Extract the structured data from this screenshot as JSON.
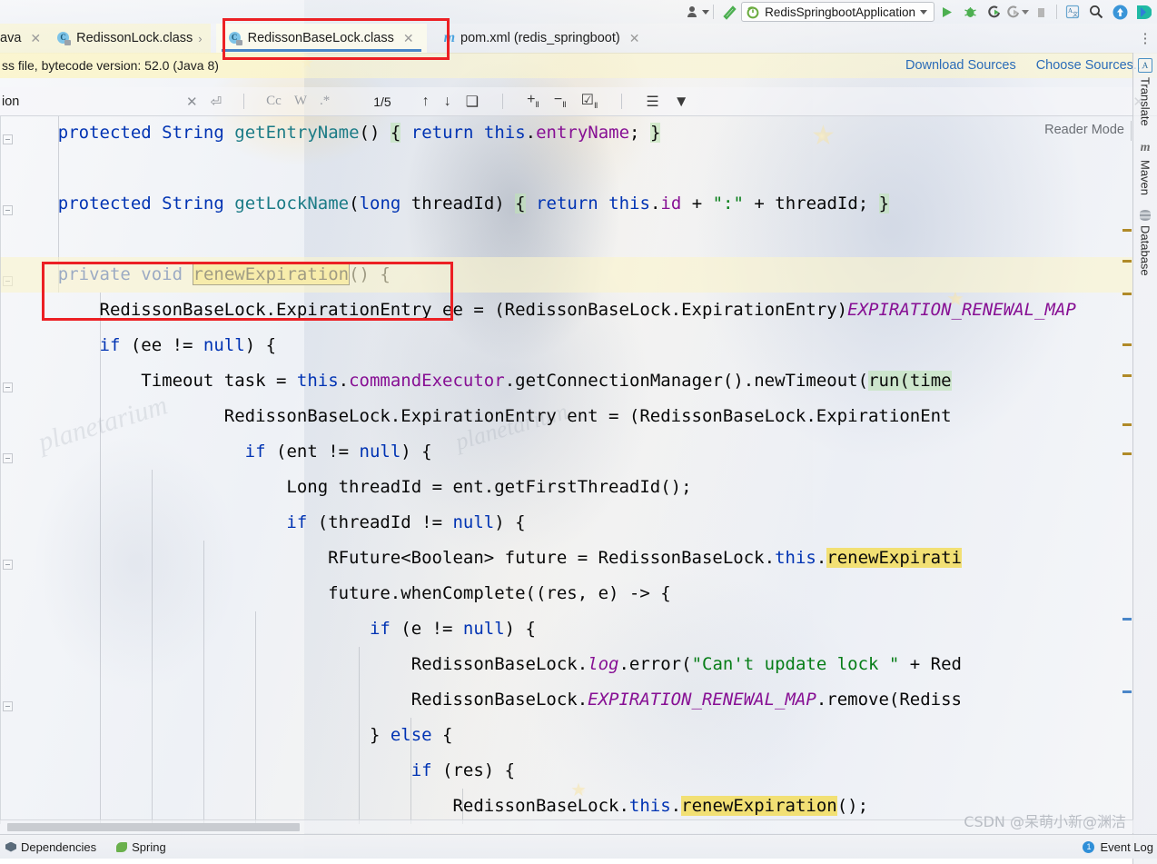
{
  "toolbar": {
    "run_configuration": "RedisSpringbootApplication",
    "icons": [
      "profile-icon",
      "build-hammer-icon",
      "run-icon",
      "debug-icon",
      "run-coverage-icon",
      "profiler-icon",
      "stop-icon",
      "translate-icon",
      "search-everywhere-icon",
      "update-project-icon",
      "ide-features-icon"
    ]
  },
  "tabs": [
    {
      "label": "ava",
      "icon": "java-file-icon",
      "active": false,
      "closable": true
    },
    {
      "label": "RedissonLock.class",
      "icon": "class-file-icon",
      "active": false,
      "closable": false
    },
    {
      "label": "RedissonBaseLock.class",
      "icon": "class-file-icon",
      "active": true,
      "closable": true
    },
    {
      "label": "pom.xml (redis_springboot)",
      "icon": "maven-file-icon",
      "active": false,
      "closable": true
    }
  ],
  "notification": {
    "text": "ss file, bytecode version: 52.0 (Java 8)",
    "actions": [
      "Download Sources",
      "Choose Sources..."
    ]
  },
  "find": {
    "query": "ion",
    "match_count": "1/5",
    "options": [
      "Cc",
      "W",
      ".*"
    ],
    "buttons": [
      "close-find-icon",
      "replace-toggle-icon",
      "prev-match-icon",
      "next-match-icon",
      "select-all-icon",
      "add-line-icon",
      "remove-line-icon",
      "toggle-lines-icon",
      "filter-results-icon",
      "filter-icon"
    ]
  },
  "editor": {
    "reader_mode_label": "Reader Mode",
    "lines": [
      {
        "id": 1,
        "indent": 2,
        "tokens": [
          {
            "t": "protected",
            "c": "kw"
          },
          {
            "t": " ",
            "c": "plain"
          },
          {
            "t": "String",
            "c": "kw"
          },
          {
            "t": " ",
            "c": "plain"
          },
          {
            "t": "getEntryName",
            "c": "fn"
          },
          {
            "t": "() ",
            "c": "plain"
          },
          {
            "t": "{",
            "c": "hl-green-tok"
          },
          {
            "t": " ",
            "c": "plain"
          },
          {
            "t": "return",
            "c": "kw"
          },
          {
            "t": " ",
            "c": "plain"
          },
          {
            "t": "this",
            "c": "kw"
          },
          {
            "t": ".",
            "c": "plain"
          },
          {
            "t": "entryName",
            "c": "fld"
          },
          {
            "t": "; ",
            "c": "plain"
          },
          {
            "t": "}",
            "c": "hl-green-tok"
          }
        ]
      },
      {
        "id": 2,
        "indent": 2,
        "tokens": []
      },
      {
        "id": 3,
        "indent": 2,
        "tokens": [
          {
            "t": "protected",
            "c": "kw"
          },
          {
            "t": " ",
            "c": "plain"
          },
          {
            "t": "String",
            "c": "kw"
          },
          {
            "t": " ",
            "c": "plain"
          },
          {
            "t": "getLockName",
            "c": "fn"
          },
          {
            "t": "(",
            "c": "plain"
          },
          {
            "t": "long",
            "c": "kw"
          },
          {
            "t": " threadId) ",
            "c": "plain"
          },
          {
            "t": "{",
            "c": "hl-green-tok"
          },
          {
            "t": " ",
            "c": "plain"
          },
          {
            "t": "return",
            "c": "kw"
          },
          {
            "t": " ",
            "c": "plain"
          },
          {
            "t": "this",
            "c": "kw"
          },
          {
            "t": ".",
            "c": "plain"
          },
          {
            "t": "id",
            "c": "fld"
          },
          {
            "t": " + ",
            "c": "plain"
          },
          {
            "t": "\":\"",
            "c": "str"
          },
          {
            "t": " + threadId; ",
            "c": "plain"
          },
          {
            "t": "}",
            "c": "hl-green-tok"
          }
        ]
      },
      {
        "id": 4,
        "indent": 2,
        "tokens": []
      },
      {
        "id": 5,
        "indent": 2,
        "current": true,
        "tokens": [
          {
            "t": "private",
            "c": "kw"
          },
          {
            "t": " ",
            "c": "plain"
          },
          {
            "t": "void",
            "c": "kw"
          },
          {
            "t": " ",
            "c": "plain"
          },
          {
            "t": "renewExpiration",
            "c": "hl-yellow-tok caret-box"
          },
          {
            "t": "() {",
            "c": "plain"
          }
        ]
      },
      {
        "id": 6,
        "indent": 4,
        "tokens": [
          {
            "t": "RedissonBaseLock.ExpirationEntry ee = (RedissonBaseLock.ExpirationEntry)",
            "c": "plain"
          },
          {
            "t": "EXPIRATION_RENEWAL_MAP",
            "c": "stat"
          }
        ]
      },
      {
        "id": 7,
        "indent": 4,
        "tokens": [
          {
            "t": "if",
            "c": "kw"
          },
          {
            "t": " (ee != ",
            "c": "plain"
          },
          {
            "t": "null",
            "c": "kw"
          },
          {
            "t": ") {",
            "c": "plain"
          }
        ]
      },
      {
        "id": 8,
        "indent": 6,
        "tokens": [
          {
            "t": "Timeout task = ",
            "c": "plain"
          },
          {
            "t": "this",
            "c": "kw"
          },
          {
            "t": ".",
            "c": "plain"
          },
          {
            "t": "commandExecutor",
            "c": "fld"
          },
          {
            "t": ".getConnectionManager().newTimeout(",
            "c": "plain"
          },
          {
            "t": "run(time",
            "c": "hl-green-tok"
          }
        ]
      },
      {
        "id": 9,
        "indent": 10,
        "tokens": [
          {
            "t": "RedissonBaseLock.ExpirationEntry ent = (RedissonBaseLock.ExpirationEnt",
            "c": "plain"
          }
        ]
      },
      {
        "id": 10,
        "indent": 11,
        "tokens": [
          {
            "t": "if",
            "c": "kw"
          },
          {
            "t": " (ent != ",
            "c": "plain"
          },
          {
            "t": "null",
            "c": "kw"
          },
          {
            "t": ") {",
            "c": "plain"
          }
        ]
      },
      {
        "id": 11,
        "indent": 13,
        "tokens": [
          {
            "t": "Long threadId = ent.getFirstThreadId();",
            "c": "plain"
          }
        ]
      },
      {
        "id": 12,
        "indent": 13,
        "tokens": [
          {
            "t": "if",
            "c": "kw"
          },
          {
            "t": " (threadId != ",
            "c": "plain"
          },
          {
            "t": "null",
            "c": "kw"
          },
          {
            "t": ") {",
            "c": "plain"
          }
        ]
      },
      {
        "id": 13,
        "indent": 15,
        "tokens": [
          {
            "t": "RFuture<Boolean> future = RedissonBaseLock.",
            "c": "plain"
          },
          {
            "t": "this",
            "c": "kw"
          },
          {
            "t": ".",
            "c": "plain"
          },
          {
            "t": "renewExpirati",
            "c": "hl-yellow-tok"
          }
        ]
      },
      {
        "id": 14,
        "indent": 15,
        "tokens": [
          {
            "t": "future.whenComplete((res, e) -> {",
            "c": "plain"
          }
        ]
      },
      {
        "id": 15,
        "indent": 17,
        "tokens": [
          {
            "t": "if",
            "c": "kw"
          },
          {
            "t": " (e != ",
            "c": "plain"
          },
          {
            "t": "null",
            "c": "kw"
          },
          {
            "t": ") {",
            "c": "plain"
          }
        ]
      },
      {
        "id": 16,
        "indent": 19,
        "tokens": [
          {
            "t": "RedissonBaseLock.",
            "c": "plain"
          },
          {
            "t": "log",
            "c": "stat"
          },
          {
            "t": ".error(",
            "c": "plain"
          },
          {
            "t": "\"Can't update lock \"",
            "c": "str"
          },
          {
            "t": " + Red",
            "c": "plain"
          }
        ]
      },
      {
        "id": 17,
        "indent": 19,
        "tokens": [
          {
            "t": "RedissonBaseLock.",
            "c": "plain"
          },
          {
            "t": "EXPIRATION_RENEWAL_MAP",
            "c": "stat"
          },
          {
            "t": ".remove(Rediss",
            "c": "plain"
          }
        ]
      },
      {
        "id": 18,
        "indent": 17,
        "tokens": [
          {
            "t": "} ",
            "c": "plain"
          },
          {
            "t": "else",
            "c": "kw"
          },
          {
            "t": " {",
            "c": "plain"
          }
        ]
      },
      {
        "id": 19,
        "indent": 19,
        "tokens": [
          {
            "t": "if",
            "c": "kw"
          },
          {
            "t": " (res) {",
            "c": "plain"
          }
        ]
      },
      {
        "id": 20,
        "indent": 21,
        "tokens": [
          {
            "t": "RedissonBaseLock.",
            "c": "plain"
          },
          {
            "t": "this",
            "c": "kw"
          },
          {
            "t": ".",
            "c": "plain"
          },
          {
            "t": "renewExpiration",
            "c": "hl-yellow-tok"
          },
          {
            "t": "();",
            "c": "plain"
          }
        ]
      }
    ]
  },
  "right_sidebar": [
    {
      "label": "Translate",
      "icon": "translate-icon"
    },
    {
      "label": "Maven",
      "icon": "maven-icon"
    },
    {
      "label": "Database",
      "icon": "database-icon"
    }
  ],
  "bottom_bar": {
    "items": [
      {
        "label": "Dependencies",
        "icon": "dependencies-icon"
      },
      {
        "label": "Spring",
        "icon": "spring-icon"
      }
    ],
    "right_items": [
      {
        "label": "Event Log",
        "icon": "event-log-icon",
        "badge": "1"
      }
    ]
  },
  "watermark": "CSDN @呆萌小新@渊洁",
  "wallpaper_text": [
    "planetarium",
    "planetarium"
  ],
  "colors": {
    "accent_blue": "#4a86c8",
    "keyword": "#0033b3",
    "string": "#067d17",
    "field": "#871094",
    "method": "#1b7b86",
    "highlight_yellow": "#f2e074",
    "annotation_red": "#ec2024",
    "link_blue": "#2b6cb8",
    "notification_bg": "#fbf5cd"
  }
}
